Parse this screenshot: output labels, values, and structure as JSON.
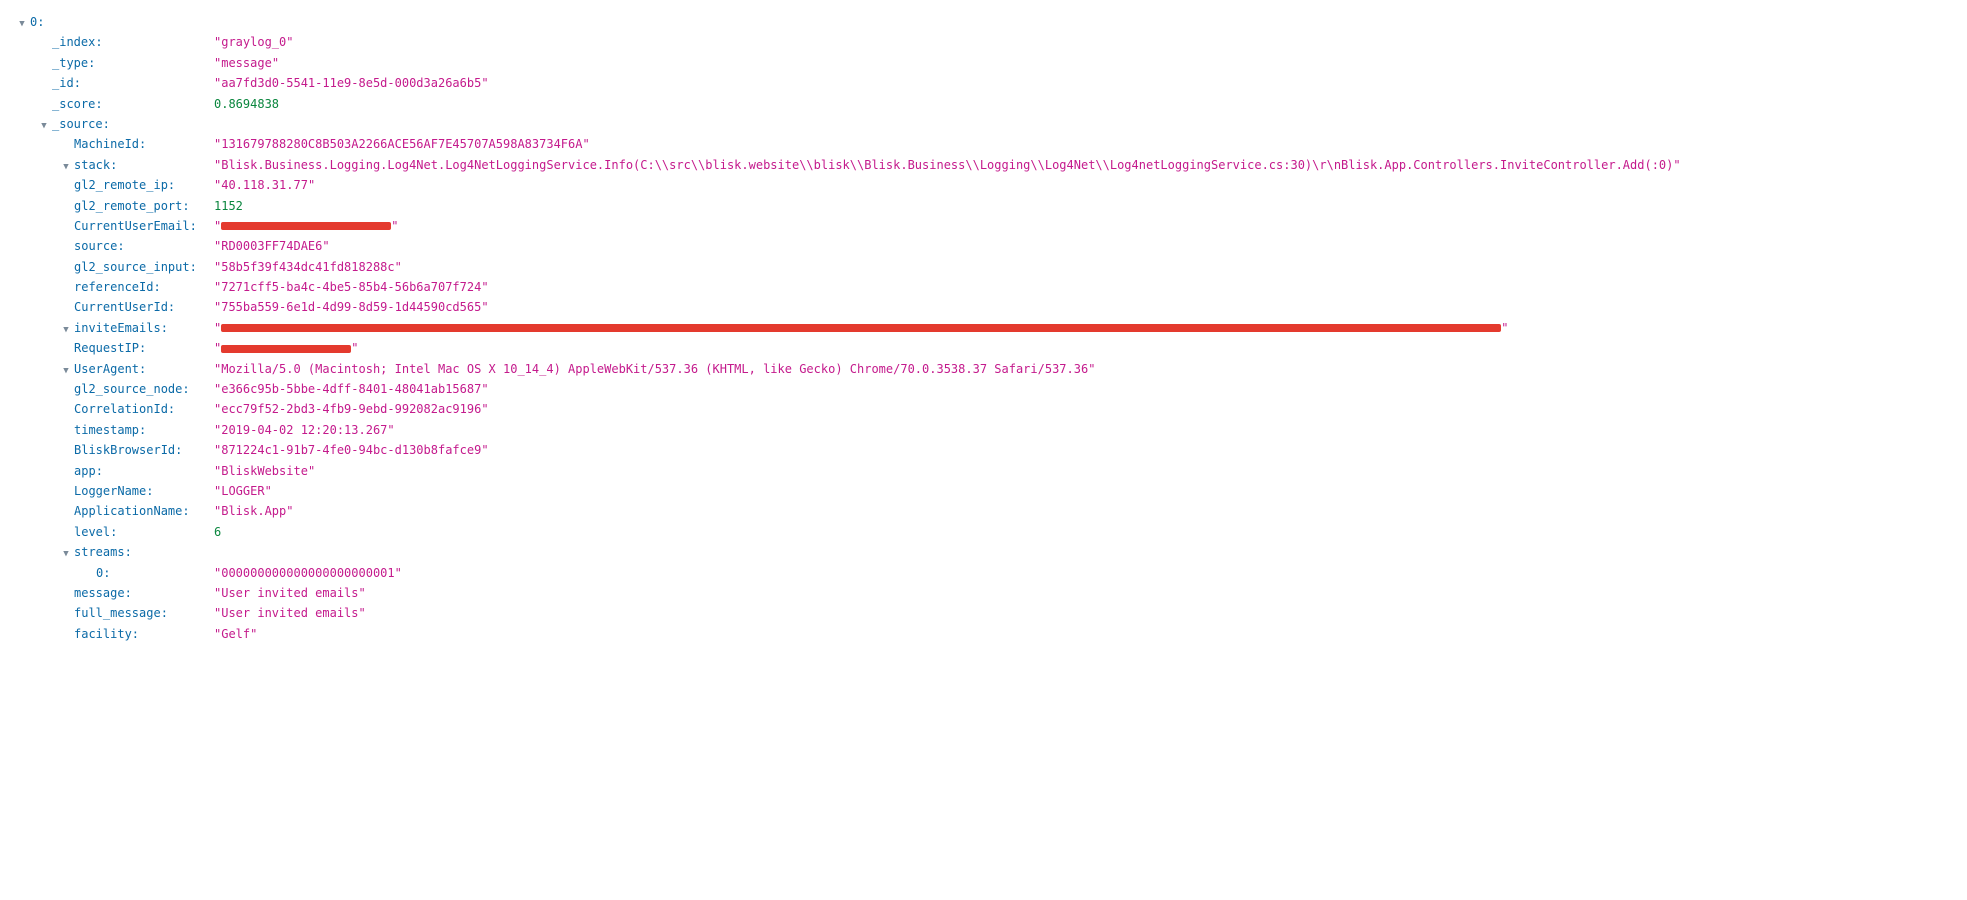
{
  "root": {
    "label": "0",
    "fields": [
      {
        "key": "_index",
        "type": "str",
        "value": "graylog_0",
        "expandable": false,
        "indent": 1
      },
      {
        "key": "_type",
        "type": "str",
        "value": "message",
        "expandable": false,
        "indent": 1
      },
      {
        "key": "_id",
        "type": "str",
        "value": "aa7fd3d0-5541-11e9-8e5d-000d3a26a6b5",
        "expandable": false,
        "indent": 1
      },
      {
        "key": "_score",
        "type": "num",
        "value": "0.8694838",
        "expandable": false,
        "indent": 1
      },
      {
        "key": "_source",
        "type": "obj",
        "expandable": true,
        "indent": 1
      },
      {
        "key": "MachineId",
        "type": "str",
        "value": "131679788280C8B503A2266ACE56AF7E45707A598A83734F6A",
        "expandable": false,
        "indent": 2
      },
      {
        "key": "stack",
        "type": "str",
        "value": "Blisk.Business.Logging.Log4Net.Log4NetLoggingService.Info(C:\\\\src\\\\blisk.website\\\\blisk\\\\Blisk.Business\\\\Logging\\\\Log4Net\\\\Log4netLoggingService.cs:30)\\r\\nBlisk.App.Controllers.InviteController.Add(:0)",
        "expandable": true,
        "indent": 2
      },
      {
        "key": "gl2_remote_ip",
        "type": "str",
        "value": "40.118.31.77",
        "expandable": false,
        "indent": 2
      },
      {
        "key": "gl2_remote_port",
        "type": "num",
        "value": "1152",
        "expandable": false,
        "indent": 2
      },
      {
        "key": "CurrentUserEmail",
        "type": "redacted",
        "redactWidth": 170,
        "expandable": false,
        "indent": 2
      },
      {
        "key": "source",
        "type": "str",
        "value": "RD0003FF74DAE6",
        "expandable": false,
        "indent": 2
      },
      {
        "key": "gl2_source_input",
        "type": "str",
        "value": "58b5f39f434dc41fd818288c",
        "expandable": false,
        "indent": 2
      },
      {
        "key": "referenceId",
        "type": "str",
        "value": "7271cff5-ba4c-4be5-85b4-56b6a707f724",
        "expandable": false,
        "indent": 2
      },
      {
        "key": "CurrentUserId",
        "type": "str",
        "value": "755ba559-6e1d-4d99-8d59-1d44590cd565",
        "expandable": false,
        "indent": 2
      },
      {
        "key": "inviteEmails",
        "type": "redacted",
        "redactWidth": 1280,
        "expandable": true,
        "indent": 2
      },
      {
        "key": "RequestIP",
        "type": "redacted",
        "redactWidth": 130,
        "expandable": false,
        "indent": 2
      },
      {
        "key": "UserAgent",
        "type": "str",
        "value": "Mozilla/5.0 (Macintosh; Intel Mac OS X 10_14_4) AppleWebKit/537.36 (KHTML, like Gecko) Chrome/70.0.3538.37 Safari/537.36",
        "expandable": true,
        "indent": 2
      },
      {
        "key": "gl2_source_node",
        "type": "str",
        "value": "e366c95b-5bbe-4dff-8401-48041ab15687",
        "expandable": false,
        "indent": 2
      },
      {
        "key": "CorrelationId",
        "type": "str",
        "value": "ecc79f52-2bd3-4fb9-9ebd-992082ac9196",
        "expandable": false,
        "indent": 2
      },
      {
        "key": "timestamp",
        "type": "str",
        "value": "2019-04-02 12:20:13.267",
        "expandable": false,
        "indent": 2
      },
      {
        "key": "BliskBrowserId",
        "type": "str",
        "value": "871224c1-91b7-4fe0-94bc-d130b8fafce9",
        "expandable": false,
        "indent": 2
      },
      {
        "key": "app",
        "type": "str",
        "value": "BliskWebsite",
        "expandable": false,
        "indent": 2
      },
      {
        "key": "LoggerName",
        "type": "str",
        "value": "LOGGER",
        "expandable": false,
        "indent": 2
      },
      {
        "key": "ApplicationName",
        "type": "str",
        "value": "Blisk.App",
        "expandable": false,
        "indent": 2
      },
      {
        "key": "level",
        "type": "num",
        "value": "6",
        "expandable": false,
        "indent": 2
      },
      {
        "key": "streams",
        "type": "obj",
        "expandable": true,
        "indent": 2
      },
      {
        "key": "0",
        "type": "str",
        "value": "000000000000000000000001",
        "expandable": false,
        "indent": 3
      },
      {
        "key": "message",
        "type": "str",
        "value": "User invited emails",
        "expandable": false,
        "indent": 2
      },
      {
        "key": "full_message",
        "type": "str",
        "value": "User invited emails",
        "expandable": false,
        "indent": 2
      },
      {
        "key": "facility",
        "type": "str",
        "value": "Gelf",
        "expandable": false,
        "indent": 2
      }
    ]
  }
}
